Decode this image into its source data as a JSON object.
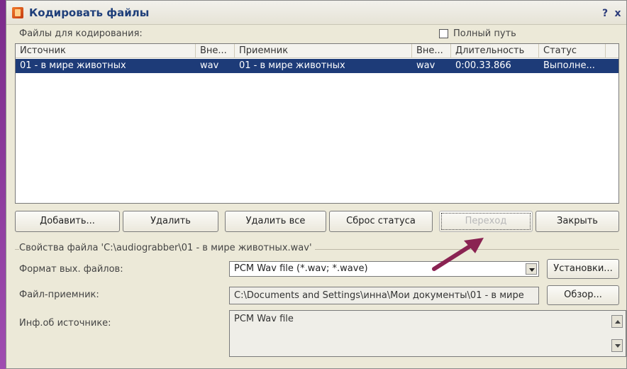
{
  "window": {
    "title": "Кодировать файлы",
    "help_label": "?",
    "close_label": "x"
  },
  "files_label": "Файлы для кодирования:",
  "full_path_label": "Полный путь",
  "table": {
    "columns": [
      "Источник",
      "Вне...",
      "Приемник",
      "Вне...",
      "Длительность",
      "Статус"
    ],
    "rows": [
      [
        "01 - в мире животных",
        "wav",
        "01 - в мире животных",
        "wav",
        "0:00.33.866",
        "Выполне..."
      ]
    ]
  },
  "buttons": {
    "add": "Добавить...",
    "remove": "Удалить",
    "remove_all": "Удалить все",
    "reset_status": "Сброс статуса",
    "go": "Переход",
    "close": "Закрыть"
  },
  "properties": {
    "group_label": "Свойства файла 'C:\\audiograbber\\01 - в мире животных.wav'",
    "format_label": "Формат вых. файлов:",
    "format_value": "PCM Wav file (*.wav; *.wave)",
    "settings_button": "Установки...",
    "dest_label": "Файл-приемник:",
    "dest_value": "C:\\Documents and Settings\\инна\\Мои документы\\01 - в мире",
    "browse_button": "Обзор...",
    "source_info_label": "Инф.об источнике:",
    "source_info_value": "PCM Wav file"
  },
  "colors": {
    "selection": "#1d3b78",
    "annotation_arrow": "#8a2352"
  }
}
